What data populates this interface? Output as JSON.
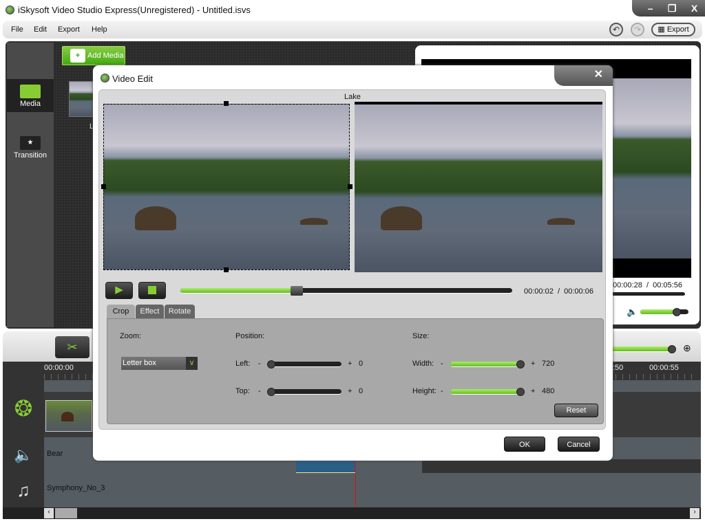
{
  "window": {
    "title": "iSkysoft Video Studio Express(Unregistered) - Untitled.isvs",
    "controls": [
      "minimize",
      "restore",
      "close"
    ]
  },
  "menu": {
    "items": [
      "File",
      "Edit",
      "Export",
      "Help"
    ],
    "export_label": "Export"
  },
  "sidebar": {
    "items": [
      {
        "label": "Media",
        "icon": "folder-film-icon"
      },
      {
        "label": "Transition",
        "icon": "folder-star-icon"
      }
    ]
  },
  "library": {
    "add_media_label": "Add Media",
    "thumb_caption": "L"
  },
  "preview": {
    "current_time": "00:00:28",
    "separator": "/",
    "total_time": "00:05:56",
    "volume": 0.8
  },
  "timeline": {
    "ruler_start": "00:00:00",
    "ruler_partial": ":50",
    "ruler_end": "00:00:55",
    "zoom_level": 1.0,
    "tracks": [
      {
        "type": "video",
        "icon": "film-reel-icon"
      },
      {
        "type": "audio",
        "label": "Bear",
        "icon": "speaker-icon"
      },
      {
        "type": "music",
        "label": "Symphony_No_3",
        "icon": "music-note-icon"
      }
    ]
  },
  "dialog": {
    "title": "Video Edit",
    "clip_name": "Lake",
    "playback": {
      "current": "00:00:02",
      "separator": "/",
      "total": "00:00:06",
      "progress": 0.35
    },
    "tabs": [
      "Crop",
      "Effect",
      "Rotate"
    ],
    "active_tab": "Crop",
    "crop": {
      "zoom_label": "Zoom:",
      "zoom_value": "Letter box",
      "position_label": "Position:",
      "left_label": "Left:",
      "left_value": "0",
      "top_label": "Top:",
      "top_value": "0",
      "size_label": "Size:",
      "width_label": "Width:",
      "width_value": "720",
      "height_label": "Height:",
      "height_value": "480",
      "minus": "-",
      "plus": "+",
      "reset_label": "Reset"
    },
    "ok_label": "OK",
    "cancel_label": "Cancel"
  },
  "colors": {
    "accent": "#77bb22"
  }
}
